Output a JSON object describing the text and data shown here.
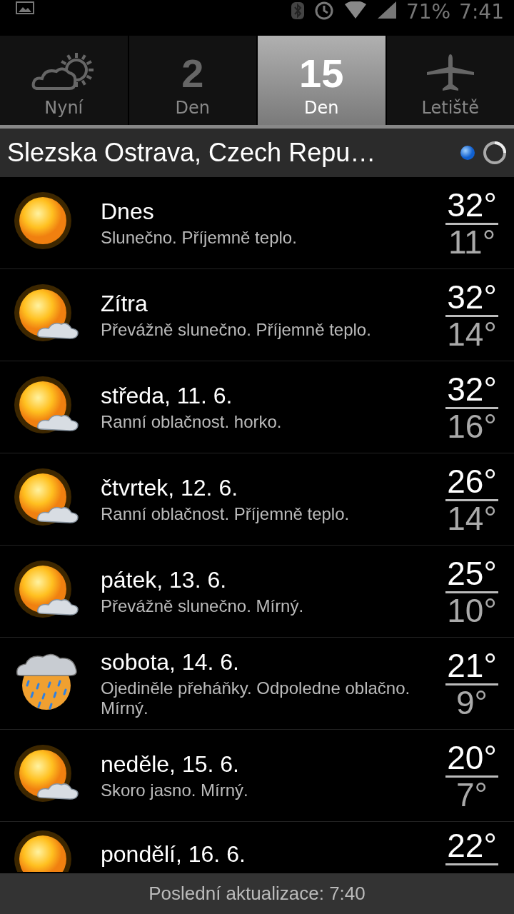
{
  "status_bar": {
    "battery": "71%",
    "time": "7:41"
  },
  "tabs": [
    {
      "kind": "icon",
      "label": "Nyní",
      "selected": false
    },
    {
      "kind": "number",
      "number": "2",
      "label": "Den",
      "selected": false
    },
    {
      "kind": "number",
      "number": "15",
      "label": "Den",
      "selected": true
    },
    {
      "kind": "plane",
      "label": "Letiště",
      "selected": false
    }
  ],
  "location": {
    "title": "Slezska Ostrava, Czech Repu…",
    "loading": true
  },
  "days": [
    {
      "kind": "sun",
      "day": "Dnes",
      "summary": "Slunečno. Příjemně teplo.",
      "high": "32°",
      "low": "11°"
    },
    {
      "kind": "sun_cloud",
      "day": "Zítra",
      "summary": "Převážně slunečno. Příjemně teplo.",
      "high": "32°",
      "low": "14°"
    },
    {
      "kind": "sun_cloud",
      "day": "středa, 11. 6.",
      "summary": "Ranní oblačnost. horko.",
      "high": "32°",
      "low": "16°"
    },
    {
      "kind": "sun_cloud",
      "day": "čtvrtek, 12. 6.",
      "summary": "Ranní oblačnost. Příjemně teplo.",
      "high": "26°",
      "low": "14°"
    },
    {
      "kind": "sun_cloud",
      "day": "pátek, 13. 6.",
      "summary": "Převážně slunečno. Mírný.",
      "high": "25°",
      "low": "10°"
    },
    {
      "kind": "rain",
      "day": "sobota, 14. 6.",
      "summary": "Ojediněle přeháňky. Odpoledne oblačno. Mírný.",
      "high": "21°",
      "low": "9°"
    },
    {
      "kind": "sun_cloud",
      "day": "neděle, 15. 6.",
      "summary": "Skoro jasno. Mírný.",
      "high": "20°",
      "low": "7°"
    },
    {
      "kind": "sun",
      "day": "pondělí, 16. 6.",
      "high": "22°"
    }
  ],
  "footer": "Poslední aktualizace: 7:40"
}
